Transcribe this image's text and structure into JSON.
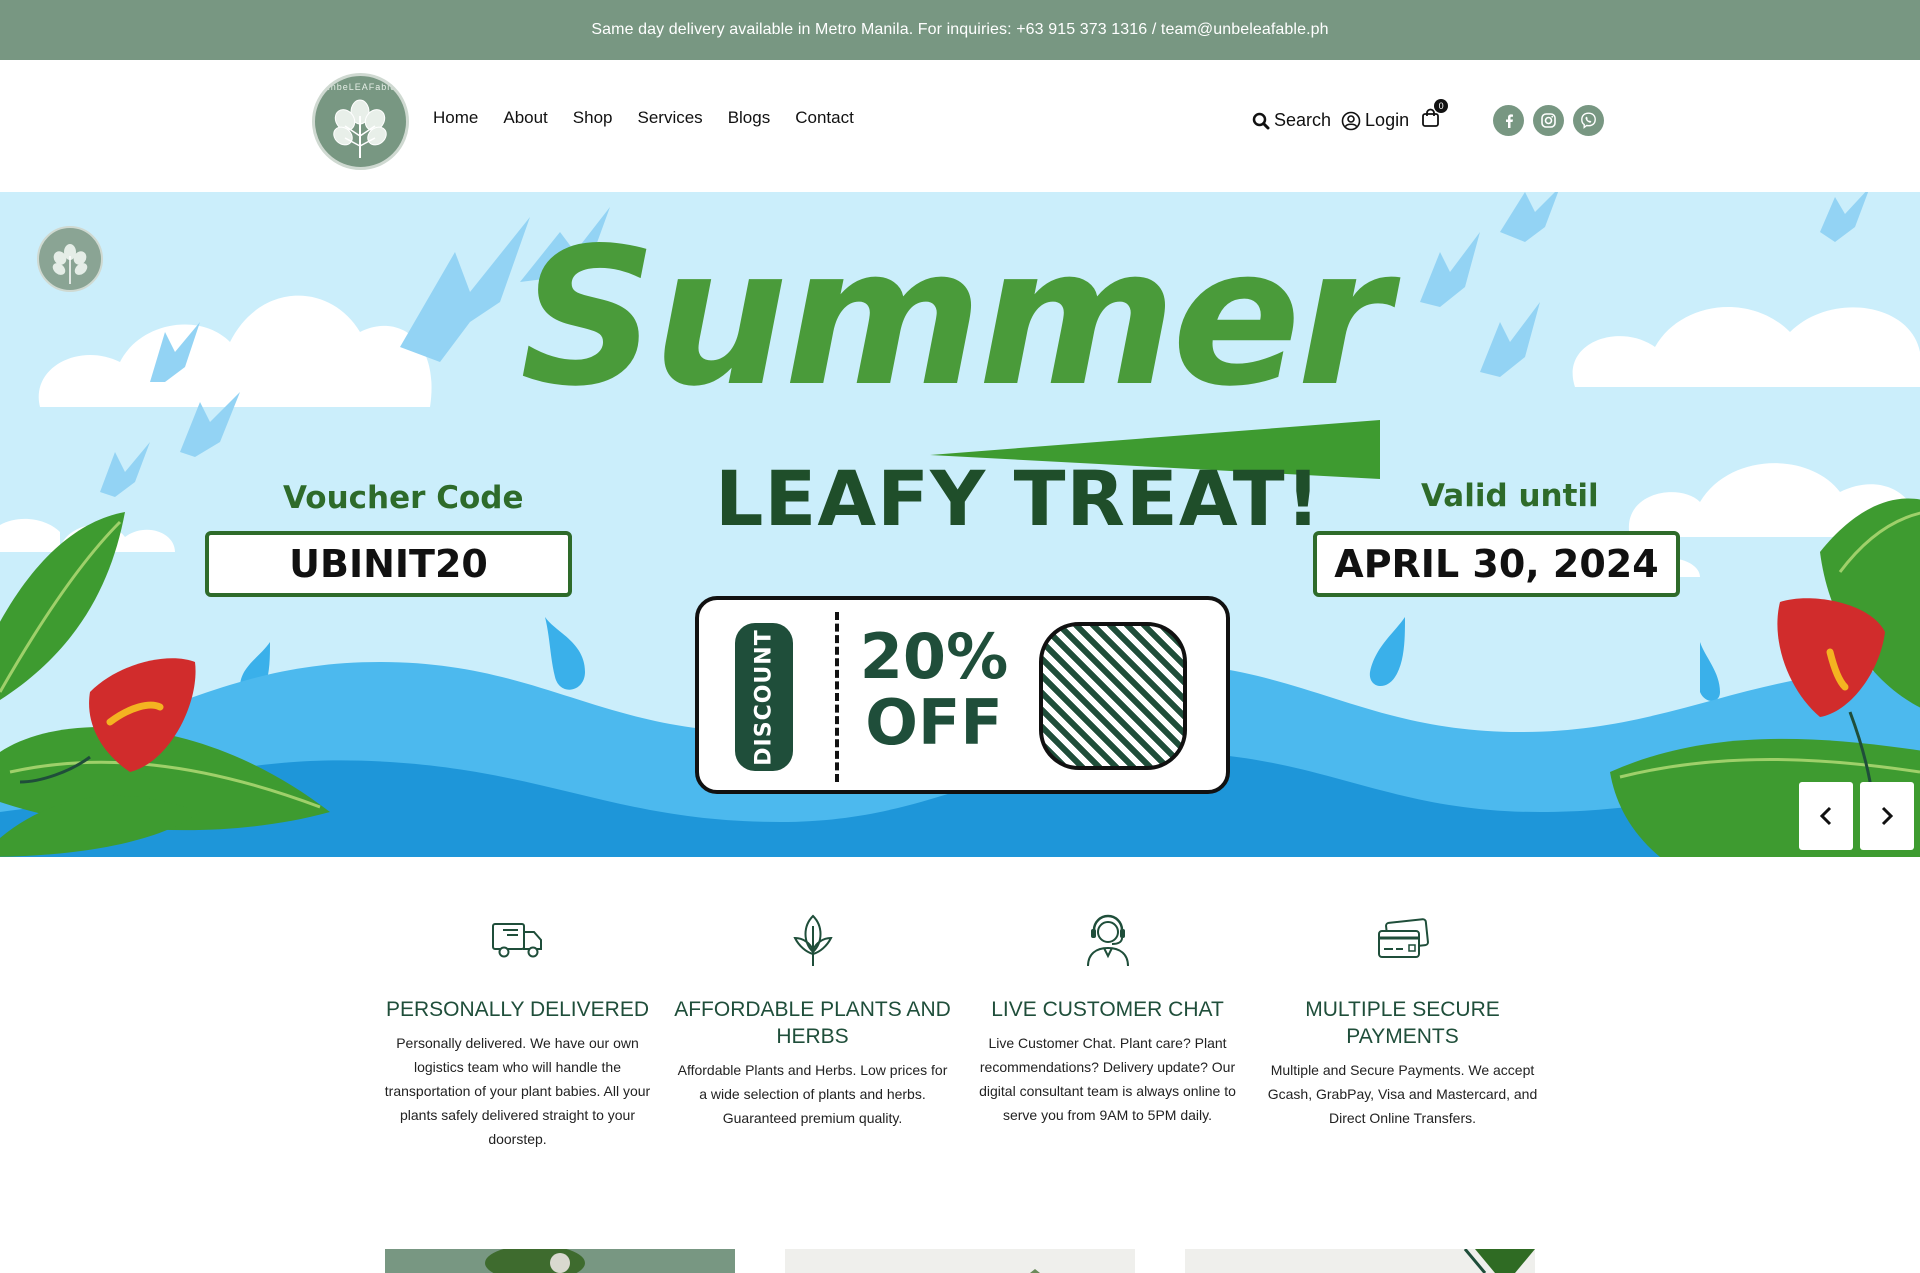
{
  "announcement": {
    "text": "Same day delivery available in Metro Manila. For inquiries: +63 915 373 1316 / team@unbeleafable.ph"
  },
  "header": {
    "logo_text": "unbeLEAFable",
    "nav": [
      {
        "label": "Home"
      },
      {
        "label": "About"
      },
      {
        "label": "Shop"
      },
      {
        "label": "Services"
      },
      {
        "label": "Blogs"
      },
      {
        "label": "Contact"
      }
    ],
    "search_label": "Search",
    "login_label": "Login",
    "cart_count": "0",
    "social_icons": [
      "facebook-icon",
      "instagram-icon",
      "viber-icon"
    ]
  },
  "hero": {
    "title": "Summer",
    "subtitle": "LEAFY TREAT!",
    "voucher_label": "Voucher Code",
    "voucher_code": "UBINIT20",
    "valid_label": "Valid until",
    "valid_date": "APRIL 30, 2024",
    "discount_tag": "DISCOUNT",
    "discount_value_line1": "20%",
    "discount_value_line2": "OFF"
  },
  "features": [
    {
      "icon": "delivery-truck-icon",
      "title": "PERSONALLY DELIVERED",
      "text": "Personally delivered. We have our own logistics team who will handle the transportation of your plant babies. All your plants safely delivered straight to your doorstep."
    },
    {
      "icon": "plant-sprout-icon",
      "title": "AFFORDABLE PLANTS AND HERBS",
      "text": "Affordable Plants and Herbs. Low prices for a wide selection of plants and herbs. Guaranteed premium quality."
    },
    {
      "icon": "customer-support-icon",
      "title": "LIVE CUSTOMER CHAT",
      "text": "Live Customer Chat. Plant care? Plant recommendations? Delivery update? Our digital consultant team is always online to serve you from 9AM to 5PM daily."
    },
    {
      "icon": "credit-cards-icon",
      "title": "MULTIPLE SECURE PAYMENTS",
      "text": "Multiple and Secure Payments. We accept Gcash, GrabPay, Visa and Mastercard, and Direct Online Transfers."
    }
  ],
  "colors": {
    "brand_green": "#789782",
    "dark_green": "#1f4e3a",
    "hero_green": "#4a9b3a"
  }
}
